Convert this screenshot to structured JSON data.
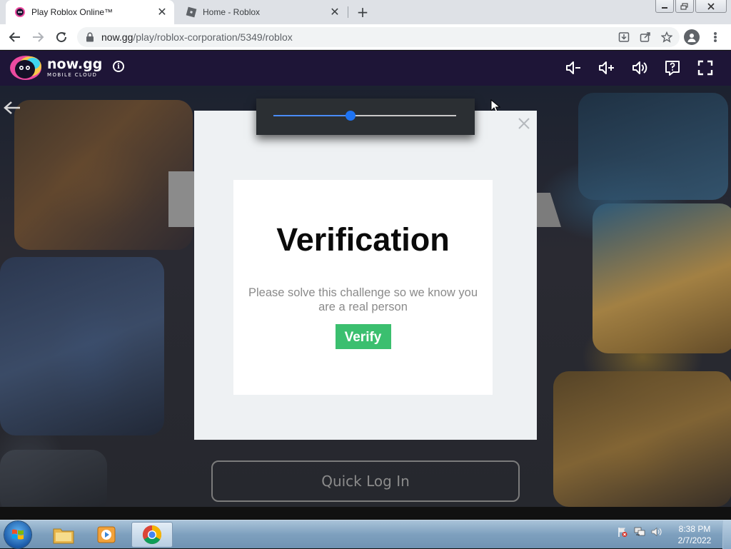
{
  "browser": {
    "tabs": [
      {
        "title": "Play Roblox Online™",
        "active": true
      },
      {
        "title": "Home - Roblox",
        "active": false
      }
    ],
    "new_tab": "+",
    "url": {
      "host": "now.gg",
      "path": "/play/roblox-corporation/5349/roblox"
    }
  },
  "nowgg": {
    "logo_main": "now.gg",
    "logo_sub": "MOBILE CLOUD",
    "controls": [
      "volume-down-icon",
      "volume-up-icon",
      "volume-icon",
      "help-icon",
      "fullscreen-icon"
    ]
  },
  "volume": {
    "level": 0.42
  },
  "game": {
    "quick_login": "Quick Log In"
  },
  "modal": {
    "title": "Verification",
    "description": "Please solve this challenge so we know you are a real person",
    "button": "Verify"
  },
  "taskbar": {
    "time": "8:38 PM",
    "date": "2/7/2022"
  },
  "colors": {
    "nowgg_bar": "#1e1537",
    "verify_button": "#3bbf6f",
    "slider_knob": "#1e73f2"
  }
}
